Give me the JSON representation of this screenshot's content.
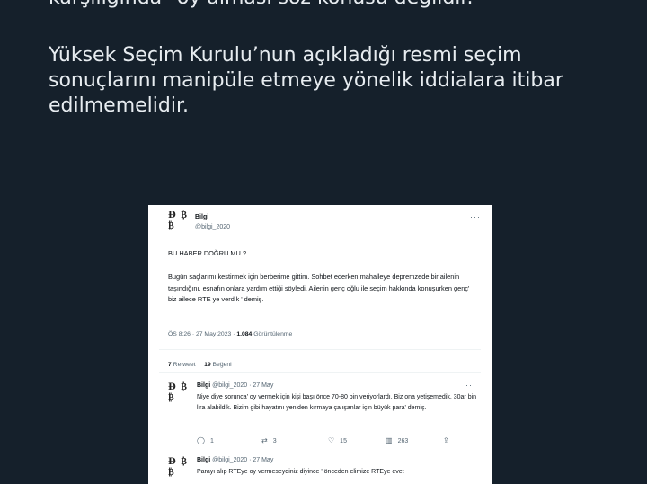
{
  "article": {
    "line1": "karşılığında “oy alması söz konusu değildir.",
    "para2": "Yüksek Seçim Kurulu’nun açıkladığı resmi seçim sonuçlarını manipüle etmeye yönelik iddialara itibar edilmemelidir."
  },
  "tweet": {
    "avatar_text": "Đ ₿ ₿",
    "name": "Bilgi",
    "handle": "@bilgi_2020",
    "more": "···",
    "question": "BU HABER DOĞRU MU ?",
    "body": "Bugün saçlarımı kestirmek için berberime gittim. Sohbet ederken mahalleye depremzede bir ailenin taşındığını, esnafın onlara yardım ettiği söyledi.  Ailenin genç oğlu ile seçim hakkında konuşurken genç' biz ailece RTE ye verdik ' demiş.",
    "time": "ÖS 8:26 · 27 May 2023 · ",
    "views_count": "1.084",
    "views_label": " Görüntülenme",
    "retweets_count": "7",
    "retweets_label": " Retweet",
    "likes_count": "19",
    "likes_label": " Beğeni"
  },
  "replies": [
    {
      "name": "Bilgi",
      "meta": " @bilgi_2020 · 27 May",
      "text": "Niye diye sorunca' oy vermek için kişi başı önce 70-80 bin veriyorlardı. Biz ona yetişemedik, 30ar bin lira  alabildik. Bizim gibi hayatını yeniden kırmaya çalışanlar için büyük para' demiş.",
      "reply_count": "1",
      "retweet_count": "3",
      "like_count": "15",
      "view_count": "263"
    },
    {
      "name": "Bilgi",
      "meta": " @bilgi_2020 · 27 May",
      "text": "Parayı alıp RTEye oy vermeseydiniz diyince ' önceden elimize RTEye evet"
    }
  ],
  "icons": {
    "reply": "reply-icon",
    "retweet": "retweet-icon",
    "like": "heart-icon",
    "views": "views-icon",
    "share": "share-icon"
  },
  "colors": {
    "background": "#15202b",
    "card": "#ffffff",
    "text_muted": "#536471"
  }
}
